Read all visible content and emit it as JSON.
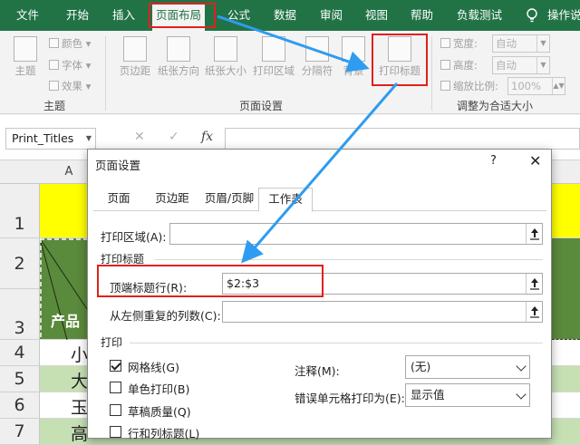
{
  "ribbon_tabs": [
    {
      "label": "文件",
      "active": false
    },
    {
      "label": "开始",
      "active": false
    },
    {
      "label": "插入",
      "active": false
    },
    {
      "label": "页面布局",
      "active": true
    },
    {
      "label": "公式",
      "active": false
    },
    {
      "label": "数据",
      "active": false
    },
    {
      "label": "审阅",
      "active": false
    },
    {
      "label": "视图",
      "active": false
    },
    {
      "label": "帮助",
      "active": false
    },
    {
      "label": "负载测试",
      "active": false
    },
    {
      "label": "操作说",
      "active": false
    }
  ],
  "ribbon": {
    "themes_group": {
      "label": "主题",
      "themes_button": "主题",
      "colors": "颜色",
      "fonts": "字体",
      "effects": "效果"
    },
    "page_setup_group": {
      "label": "页面设置",
      "buttons": [
        "页边距",
        "纸张方向",
        "纸张大小",
        "打印区域",
        "分隔符",
        "背景",
        "打印标题"
      ]
    },
    "scale_group": {
      "label": "调整为合适大小",
      "width_label": "宽度:",
      "width_value": "自动",
      "height_label": "高度:",
      "height_value": "自动",
      "scale_label": "缩放比例:",
      "scale_value": "100%"
    }
  },
  "formula_bar": {
    "name_box": "Print_Titles",
    "cancel_icon": "✕",
    "enter_icon": "✓",
    "fx_label": "fx",
    "formula": ""
  },
  "sheet": {
    "column_headers": [
      "A"
    ],
    "row_headers": [
      "1",
      "2",
      "3",
      "4",
      "5",
      "6",
      "7"
    ],
    "cells": {
      "a3": "产品",
      "a4": "小",
      "a5": "大",
      "a6": "玉",
      "a7": "高"
    },
    "colors": {
      "header_fill": "#ffff00",
      "dark_green": "#5a8a3c",
      "light_green": "#c6e0b4"
    }
  },
  "dialog": {
    "title": "页面设置",
    "help": "?",
    "close": "✕",
    "tabs": [
      {
        "label": "页面",
        "active": false
      },
      {
        "label": "页边距",
        "active": false
      },
      {
        "label": "页眉/页脚",
        "active": false
      },
      {
        "label": "工作表",
        "active": true
      }
    ],
    "print_area_label": "打印区域(A):",
    "print_area_value": "",
    "print_titles_section": "打印标题",
    "rows_to_repeat_label": "顶端标题行(R):",
    "rows_to_repeat_value": "$2:$3",
    "cols_to_repeat_label": "从左侧重复的列数(C):",
    "cols_to_repeat_value": "",
    "print_section": "打印",
    "checkboxes": [
      {
        "label": "网格线(G)",
        "checked": true
      },
      {
        "label": "单色打印(B)",
        "checked": false
      },
      {
        "label": "草稿质量(Q)",
        "checked": false
      },
      {
        "label": "行和列标题(L)",
        "checked": false
      }
    ],
    "comments_label": "注释(M):",
    "comments_value": "(无)",
    "cell_errors_label": "错误单元格打印为(E):",
    "cell_errors_value": "显示值"
  },
  "colors": {
    "excel_green": "#217346",
    "highlight_red": "#e0211d",
    "arrow_blue": "#2e9cf0"
  }
}
